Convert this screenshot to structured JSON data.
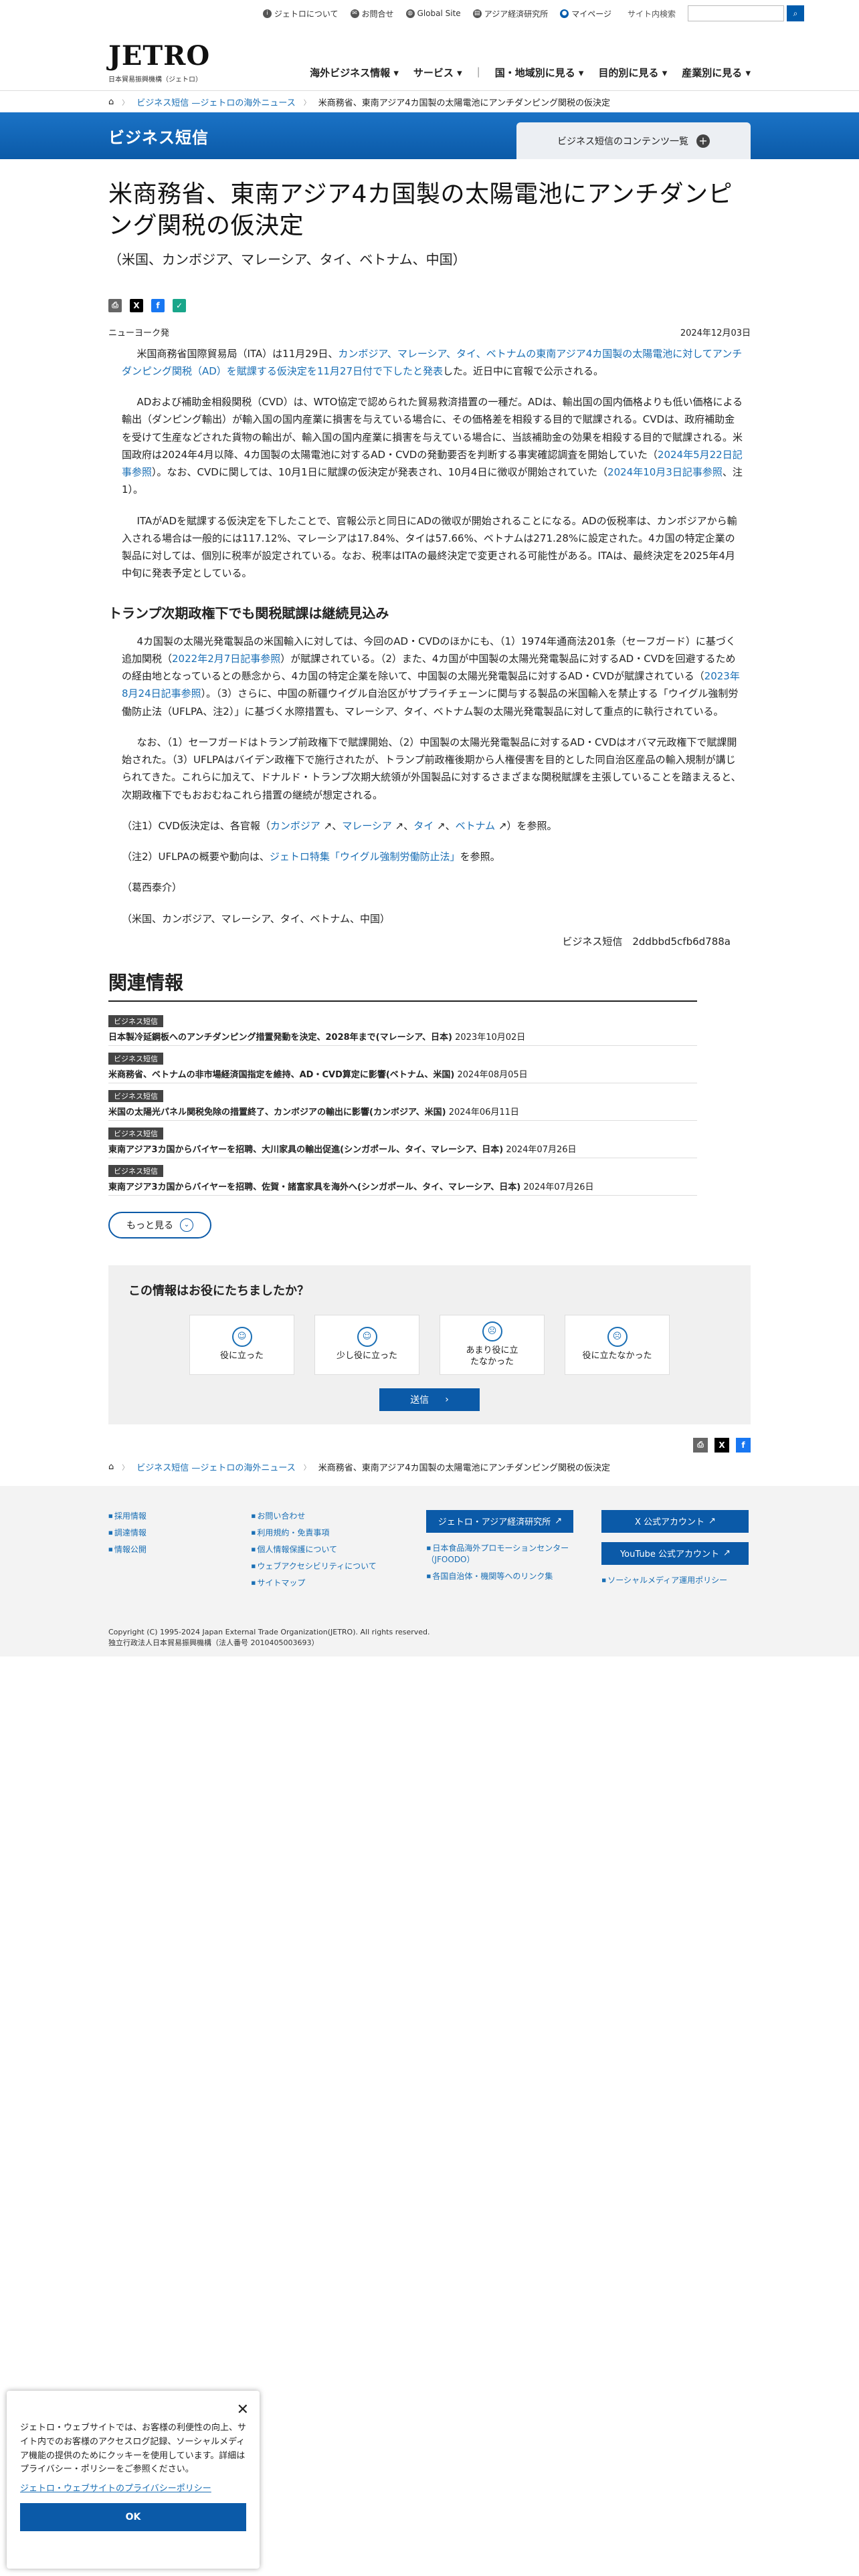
{
  "util": {
    "about": "ジェトロについて",
    "contact": "お問合せ",
    "global": "Global Site",
    "ide": "アジア経済研究所",
    "mypage": "マイページ",
    "search_label": "サイト内検索",
    "search_placeholder": ""
  },
  "logo": {
    "mark": "JETRO",
    "sub": "日本貿易振興機構（ジェトロ）"
  },
  "gnav": [
    "海外ビジネス情報 ▾",
    "サービス ▾",
    "国・地域別に見る ▾",
    "目的別に見る ▾",
    "産業別に見る ▾"
  ],
  "breadcrumb": {
    "c1": "ビジネス短信 —ジェトロの海外ニュース",
    "c2": "米商務省、東南アジア4カ国製の太陽電池にアンチダンピング関税の仮決定"
  },
  "banner": {
    "title": "ビジネス短信",
    "button": "ビジネス短信のコンテンツ一覧"
  },
  "article": {
    "title": "米商務省、東南アジア4カ国製の太陽電池にアンチダンピング関税の仮決定",
    "subtitle": "（米国、カンボジア、マレーシア、タイ、ベトナム、中国）",
    "location": "ニューヨーク発",
    "date": "2024年12月03日",
    "p1a": "米国商務省国際貿易局（ITA）は11月29日、",
    "p1link": "カンボジア、マレーシア、タイ、ベトナムの東南アジア4カ国製の太陽電池に対してアンチダンピング関税（AD）を賦課する仮決定を11月27日付で下したと発表",
    "p1b": "した。近日中に官報で公示される。",
    "p2a": "ADおよび補助金相殺関税（CVD）は、WTO協定で認められた貿易救済措置の一種だ。ADは、輸出国の国内価格よりも低い価格による輸出（ダンピング輸出）が輸入国の国内産業に損害を与えている場合に、その価格差を相殺する目的で賦課される。CVDは、政府補助金を受けて生産などされた貨物の輸出が、輸入国の国内産業に損害を与えている場合に、当該補助金の効果を相殺する目的で賦課される。米国政府は2024年4月以降、4カ国製の太陽電池に対するAD・CVDの発動要否を判断する事実確認調査を開始していた（",
    "p2link1": "2024年5月22日記事参照",
    "p2b": "）。なお、CVDに関しては、10月1日に賦課の仮決定が発表され、10月4日に徴収が開始されていた（",
    "p2link2": "2024年10月3日記事参照",
    "p2c": "、注1）。",
    "p3": "ITAがADを賦課する仮決定を下したことで、官報公示と同日にADの徴収が開始されることになる。ADの仮税率は、カンボジアから輸入される場合は一般的には117.12%、マレーシアは17.84%、タイは57.66%、ベトナムは271.28%に設定された。4カ国の特定企業の製品に対しては、個別に税率が設定されている。なお、税率はITAの最終決定で変更される可能性がある。ITAは、最終決定を2025年4月中旬に発表予定としている。",
    "h2": "トランプ次期政権下でも関税賦課は継続見込み",
    "p4a": "4カ国製の太陽光発電製品の米国輸入に対しては、今回のAD・CVDのほかにも、（1）1974年通商法201条（セーフガード）に基づく追加関税（",
    "p4link1": "2022年2月7日記事参照",
    "p4b": "）が賦課されている。（2）また、4カ国が中国製の太陽光発電製品に対するAD・CVDを回避するための経由地となっているとの懸念から、4カ国の特定企業を除いて、中国製の太陽光発電製品に対するAD・CVDが賦課されている（",
    "p4link2": "2023年8月24日記事参照",
    "p4c": "）。（3）さらに、中国の新疆ウイグル自治区がサプライチェーンに関与する製品の米国輸入を禁止する「ウイグル強制労働防止法（UFLPA、注2）」に基づく水際措置も、マレーシア、タイ、ベトナム製の太陽光発電製品に対して重点的に執行されている。",
    "p5": "なお、（1）セーフガードはトランプ前政権下で賦課開始、（2）中国製の太陽光発電製品に対するAD・CVDはオバマ元政権下で賦課開始された。（3）UFLPAはバイデン政権下で施行されたが、トランプ前政権後期から人権侵害を目的とした同自治区産品の輸入規制が講じられてきた。これらに加えて、ドナルド・トランプ次期大統領が外国製品に対するさまざまな関税賦課を主張していることを踏まえると、次期政権下でもおおむねこれら措置の継続が想定される。",
    "n1a": "（注1）CVD仮決定は、各官報（",
    "n1l1": "カンボジア",
    "n1l2": "マレーシア",
    "n1l3": "タイ",
    "n1l4": "ベトナム",
    "n1b": "）を参照。",
    "n2a": "（注2）UFLPAの概要や動向は、",
    "n2link": "ジェトロ特集「ウイグル強制労働防止法」",
    "n2b": "を参照。",
    "author": "（葛西泰介）",
    "countries": "（米国、カンボジア、マレーシア、タイ、ベトナム、中国）",
    "signature": "ビジネス短信　2ddbbd5cfb6d788a"
  },
  "related": {
    "title": "関連情報",
    "items": [
      {
        "tag": "ビジネス短信",
        "text": "日本製冷延鋼板へのアンチダンピング措置発動を決定、2028年まで(マレーシア、日本)",
        "date": "2023年10月02日"
      },
      {
        "tag": "ビジネス短信",
        "text": "米商務省、ベトナムの非市場経済国指定を維持、AD・CVD算定に影響(ベトナム、米国)",
        "date": "2024年08月05日"
      },
      {
        "tag": "ビジネス短信",
        "text": "米国の太陽光パネル関税免除の措置終了、カンボジアの輸出に影響(カンボジア、米国)",
        "date": "2024年06月11日"
      },
      {
        "tag": "ビジネス短信",
        "text": "東南アジア3カ国からバイヤーを招聘、大川家具の輸出促進(シンガポール、タイ、マレーシア、日本)",
        "date": "2024年07月26日"
      },
      {
        "tag": "ビジネス短信",
        "text": "東南アジア3カ国からバイヤーを招聘、佐賀・諸富家具を海外へ(シンガポール、タイ、マレーシア、日本)",
        "date": "2024年07月26日"
      }
    ],
    "more": "もっと見る"
  },
  "survey": {
    "question": "この情報はお役にたちましたか？",
    "options": [
      "役に立った",
      "少し役に立った",
      "あまり役に立たなかった",
      "役に立たなかった"
    ],
    "submit": "送信"
  },
  "footer": {
    "col1": [
      "採用情報",
      "調達情報",
      "情報公開"
    ],
    "col2": [
      "お問い合わせ",
      "利用規約・免責事項",
      "個人情報保護について",
      "ウェブアクセシビリティについて",
      "サイトマップ"
    ],
    "btn1": "ジェトロ・アジア経済研究所",
    "col3": [
      "日本食品海外プロモーションセンター（JFOODO）",
      "各国自治体・機関等へのリンク集"
    ],
    "btn2": "X 公式アカウント",
    "btn3": "YouTube 公式アカウント",
    "col4": [
      "ソーシャルメディア運用ポリシー"
    ],
    "copy1": "Copyright (C) 1995-2024 Japan External Trade Organization(JETRO). All rights reserved.",
    "copy2": "独立行政法人日本貿易振興機構（法人番号 2010405003693）"
  },
  "cookie": {
    "text": "ジェトロ・ウェブサイトでは、お客様の利便性の向上、サイト内でのお客様のアクセスログ記録、ソーシャルメディア機能の提供のためにクッキーを使用しています。詳細はプライバシー・ポリシーをご参照ください。",
    "link": "ジェトロ・ウェブサイトのプライバシーポリシー",
    "ok": "OK"
  }
}
